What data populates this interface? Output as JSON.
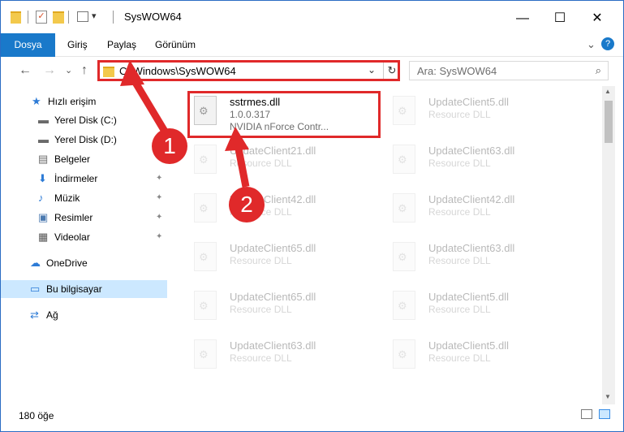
{
  "window": {
    "title": "SysWOW64",
    "controls": {
      "minimize": "—",
      "maximize": "☐",
      "close": "✕"
    }
  },
  "ribbon": {
    "tabs": [
      "Dosya",
      "Giriş",
      "Paylaş",
      "Görünüm"
    ],
    "expand": "⌄",
    "help": "?"
  },
  "nav": {
    "back": "←",
    "forward": "→",
    "recent": "⌄",
    "up": "↑"
  },
  "address": {
    "path": "C:\\Windows\\SysWOW64",
    "dropdown": "⌄",
    "refresh": "↻"
  },
  "search": {
    "placeholder": "Ara: SysWOW64",
    "icon": "⌕"
  },
  "sidebar": {
    "items": [
      {
        "label": "Hızlı erişim",
        "icon": "star-icon",
        "glyph": "★",
        "color": "#2d7bd6"
      },
      {
        "label": "Yerel Disk (C:)",
        "icon": "drive-icon",
        "glyph": "▬",
        "color": "#6a6a6a",
        "pinned": true
      },
      {
        "label": "Yerel Disk (D:)",
        "icon": "drive-icon",
        "glyph": "▬",
        "color": "#6a6a6a",
        "pinned": true
      },
      {
        "label": "Belgeler",
        "icon": "documents-icon",
        "glyph": "▤",
        "color": "#6a6a6a",
        "pinned": true
      },
      {
        "label": "İndirmeler",
        "icon": "download-icon",
        "glyph": "⬇",
        "color": "#2d7bd6",
        "pinned": true
      },
      {
        "label": "Müzik",
        "icon": "music-icon",
        "glyph": "♪",
        "color": "#2d7bd6",
        "pinned": true
      },
      {
        "label": "Resimler",
        "icon": "pictures-icon",
        "glyph": "▣",
        "color": "#4b7ab0",
        "pinned": true
      },
      {
        "label": "Videolar",
        "icon": "video-icon",
        "glyph": "▦",
        "color": "#555",
        "pinned": true
      },
      {
        "label": "OneDrive",
        "icon": "cloud-icon",
        "glyph": "☁",
        "color": "#2d7bd6"
      },
      {
        "label": "Bu bilgisayar",
        "icon": "computer-icon",
        "glyph": "▭",
        "color": "#2d7bd6",
        "selected": true
      },
      {
        "label": "Ağ",
        "icon": "network-icon",
        "glyph": "⇄",
        "color": "#2d7bd6"
      }
    ],
    "pin_glyph": "📌"
  },
  "files": {
    "primary": {
      "name": "sstrmes.dll",
      "version": "1.0.0.317",
      "description": "NVIDIA nForce Contr..."
    },
    "faded": [
      {
        "name": "UpdateClient5.dll",
        "desc": "Resource DLL"
      },
      {
        "name": "UpdateClient21.dll",
        "desc": "Resource DLL"
      },
      {
        "name": "UpdateClient63.dll",
        "desc": "Resource DLL"
      },
      {
        "name": "UpdateClient42.dll",
        "desc": "Resource DLL"
      },
      {
        "name": "UpdateClient42.dll",
        "desc": "Resource DLL"
      },
      {
        "name": "UpdateClient65.dll",
        "desc": "Resource DLL"
      },
      {
        "name": "UpdateClient63.dll",
        "desc": "Resource DLL"
      },
      {
        "name": "UpdateClient65.dll",
        "desc": "Resource DLL"
      },
      {
        "name": "UpdateClient5.dll",
        "desc": "Resource DLL"
      },
      {
        "name": "UpdateClient63.dll",
        "desc": "Resource DLL"
      },
      {
        "name": "UpdateClient5.dll",
        "desc": "Resource DLL"
      }
    ]
  },
  "status": {
    "item_count": "180 öğe"
  },
  "callouts": [
    "1",
    "2"
  ],
  "colors": {
    "accent": "#1979ca",
    "highlight": "#e0292a",
    "selected": "#cce8ff"
  }
}
